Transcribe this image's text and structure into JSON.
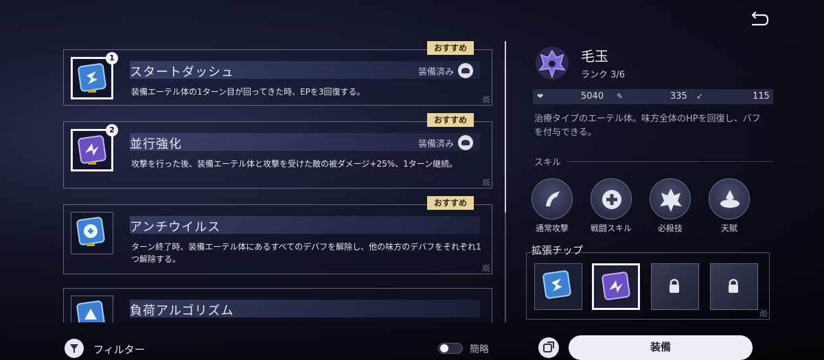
{
  "colors": {
    "accent_badge": "#e8d39a",
    "chip_blue": "#3e7fd1",
    "chip_purple": "#6a4fc0",
    "button_bg": "#eceef3"
  },
  "chips": [
    {
      "number": "1",
      "title": "スタートダッシュ",
      "badge": "おすすめ",
      "equipped_label": "装備済み",
      "description": "装備エーテル体の1ターン目が回ってきた時、EPを3回復する。",
      "icon": "dash-chip-icon"
    },
    {
      "number": "2",
      "title": "並行強化",
      "badge": "おすすめ",
      "equipped_label": "装備済み",
      "description": "攻撃を行った後、装備エーテル体と攻撃を受けた敵の被ダメージ+25%、1ターン継続。",
      "icon": "parallel-chip-icon"
    },
    {
      "title": "アンチウイルス",
      "badge": "おすすめ",
      "description": "ターン終了時、装備エーテル体にあるすべてのデバフを解除し、他の味方のデバフをそれぞれ1つ解除する。",
      "icon": "antivirus-chip-icon"
    },
    {
      "title": "負荷アルゴリズム",
      "icon": "load-algorithm-chip-icon"
    }
  ],
  "character": {
    "name": "毛玉",
    "rank": "ランク 3/6",
    "hp": "5040",
    "atk": "335",
    "spd": "115",
    "description": "治療タイプのエーテル体。味方全体のHPを回復し、バフを付与できる。"
  },
  "skills": {
    "label": "スキル",
    "items": [
      {
        "name": "通常攻撃",
        "icon": "basic-attack-icon"
      },
      {
        "name": "戦闘スキル",
        "icon": "heal-cross-icon"
      },
      {
        "name": "必殺技",
        "icon": "ultimate-emblem-icon"
      },
      {
        "name": "天賦",
        "icon": "talent-icon"
      }
    ]
  },
  "extension": {
    "label": "拡張チップ"
  },
  "bottom": {
    "filter_label": "フィルター",
    "toggle_label": "簡略",
    "toggle_on": false,
    "equip_label": "装備"
  }
}
